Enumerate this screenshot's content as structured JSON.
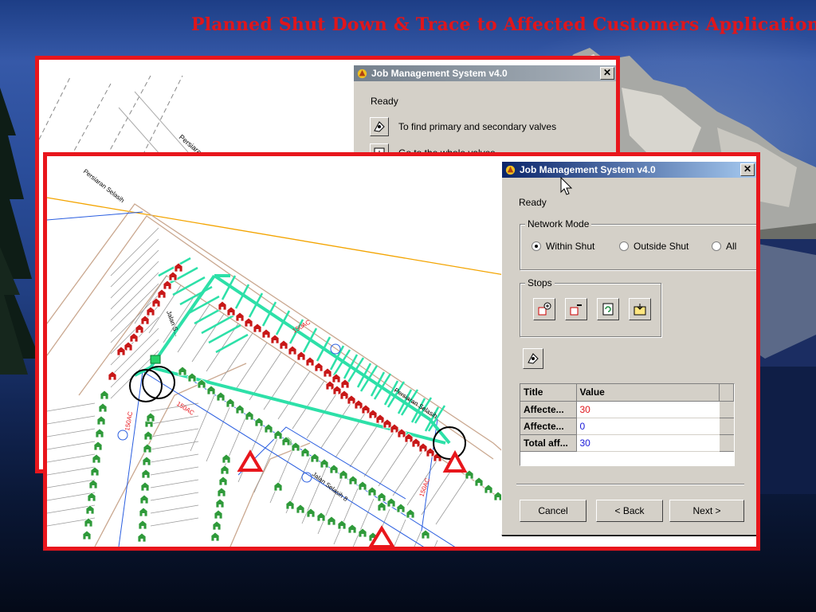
{
  "slide": {
    "title": "Planned Shut Down & Trace to Affected Customers Application",
    "title_color": "#e0161b",
    "frame_color": "#e8161c"
  },
  "back_window": {
    "dialog": {
      "title": "Job Management System v4.0",
      "close_label": "✕",
      "status": "Ready",
      "actions": [
        {
          "icon": "valve-find-icon",
          "label": "To find primary and secondary valves"
        },
        {
          "icon": "valve-goto-icon",
          "label": "Go to the whole valves"
        }
      ]
    },
    "map_labels": [
      "Persiaran Sela..."
    ]
  },
  "front_window": {
    "map": {
      "road_labels": [
        "Persiaran Selasih",
        "Persiaran Selasih",
        "Jalan Selasih 8",
        "Jalan S..."
      ],
      "pipe_labels": [
        "150AC",
        "150AC",
        "150AC",
        "150AC"
      ],
      "customer_count_marked": 30
    },
    "dialog": {
      "title": "Job Management System v4.0",
      "close_label": "✕",
      "status": "Ready",
      "network_mode": {
        "label": "Network Mode",
        "options": [
          "Within Shut",
          "Outside Shut",
          "All"
        ],
        "selected": "Within Shut"
      },
      "stops": {
        "label": "Stops",
        "buttons": [
          "add-stop-icon",
          "remove-stop-icon",
          "refresh-stops-icon",
          "export-stops-icon"
        ]
      },
      "trace_button_icon": "trace-icon",
      "grid": {
        "columns": [
          "Title",
          "Value"
        ],
        "rows": [
          {
            "title": "Affecte...",
            "value": "30",
            "value_color": "#e0161b"
          },
          {
            "title": "Affecte...",
            "value": "0",
            "value_color": "#1a1ad8"
          },
          {
            "title": "Total aff...",
            "value": "30",
            "value_color": "#1a1ad8"
          }
        ]
      },
      "buttons": {
        "cancel": "Cancel",
        "back": "< Back",
        "next": "Next >"
      }
    }
  },
  "colors": {
    "dialog_face": "#d4d0c8",
    "title_active": "#0a246a",
    "pipe_highlight": "#2de0a8",
    "customer_affected": "#c81818",
    "customer_normal": "#2f9a3a",
    "valve_marker": "#e8161c",
    "boundary_line": "#f3a400"
  }
}
